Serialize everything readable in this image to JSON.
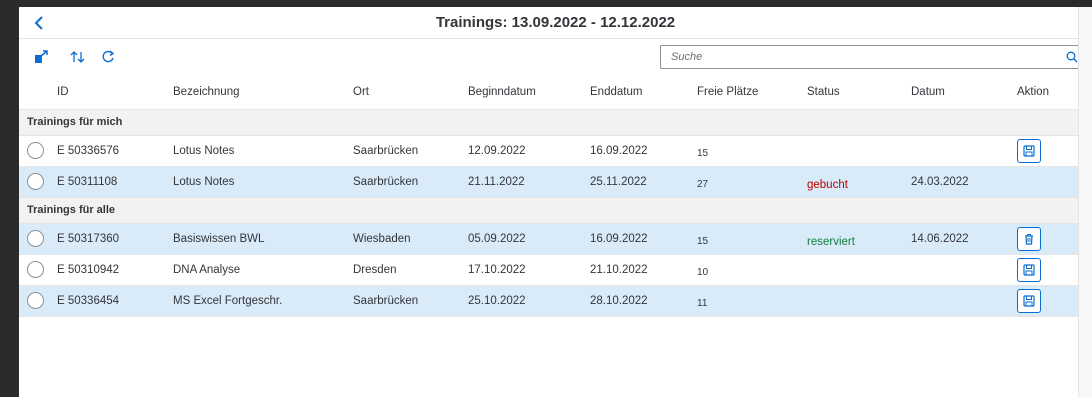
{
  "header": {
    "title": "Trainings: 13.09.2022 - 12.12.2022"
  },
  "search": {
    "placeholder": "Suche"
  },
  "columns": [
    "ID",
    "Bezeichnung",
    "Ort",
    "Beginndatum",
    "Enddatum",
    "Freie Plätze",
    "Status",
    "Datum",
    "Aktion"
  ],
  "groups": [
    {
      "label": "Trainings für mich",
      "rows": [
        {
          "id": "E 50336576",
          "name": "Lotus Notes",
          "location": "Saarbrücken",
          "start": "12.09.2022",
          "end": "16.09.2022",
          "free": "15",
          "status": "",
          "date": "",
          "action": "save-icon"
        },
        {
          "id": "E 50311108",
          "name": "Lotus Notes",
          "location": "Saarbrücken",
          "start": "21.11.2022",
          "end": "25.11.2022",
          "free": "27",
          "status": "gebucht",
          "date": "24.03.2022",
          "action": ""
        }
      ]
    },
    {
      "label": "Trainings für alle",
      "rows": [
        {
          "id": "E 50317360",
          "name": "Basiswissen BWL",
          "location": "Wiesbaden",
          "start": "05.09.2022",
          "end": "16.09.2022",
          "free": "15",
          "status": "reserviert",
          "date": "14.06.2022",
          "action": "trash-icon"
        },
        {
          "id": "E 50310942",
          "name": "DNA Analyse",
          "location": "Dresden",
          "start": "17.10.2022",
          "end": "21.10.2022",
          "free": "10",
          "status": "",
          "date": "",
          "action": "save-icon"
        },
        {
          "id": "E 50336454",
          "name": "MS Excel Fortgeschr.",
          "location": "Saarbrücken",
          "start": "25.10.2022",
          "end": "28.10.2022",
          "free": "11",
          "status": "",
          "date": "",
          "action": "save-icon"
        }
      ]
    }
  ],
  "colors": {
    "accent": "#0a6ed1",
    "booked": "#bb0000",
    "reserved": "#107e3e",
    "selected_row": "#d9ebf9"
  }
}
